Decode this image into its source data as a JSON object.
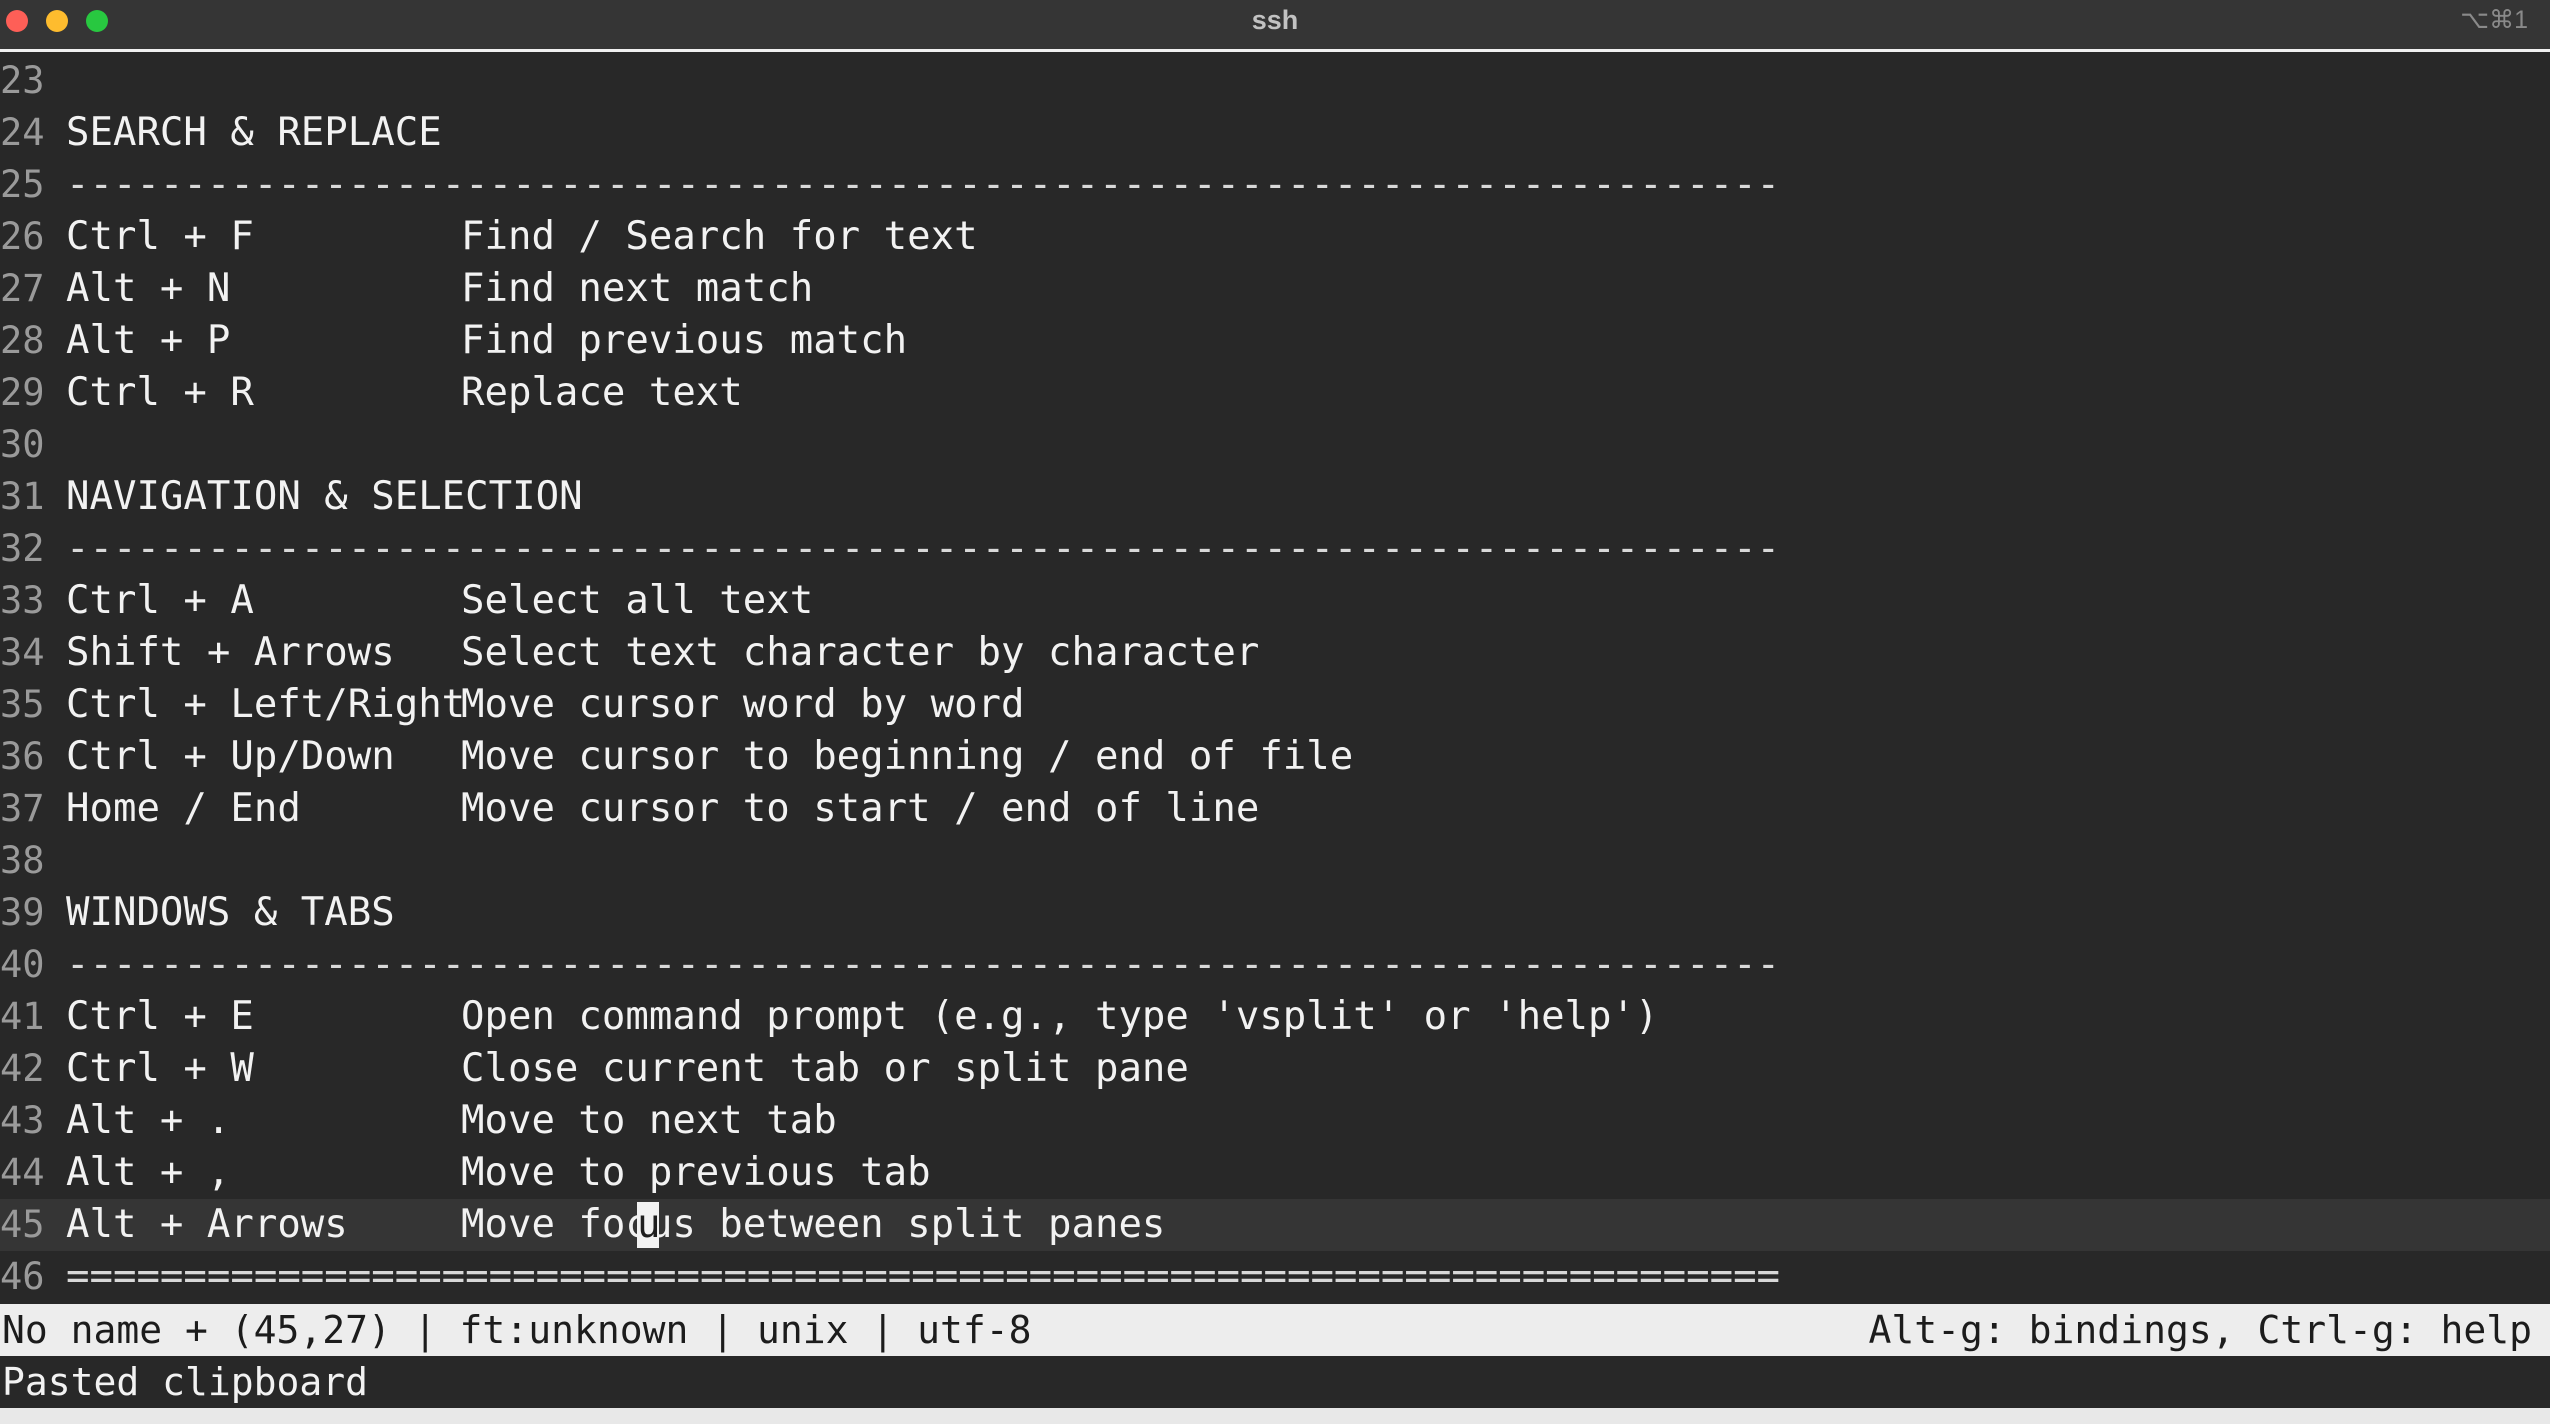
{
  "window": {
    "title": "ssh",
    "shortcut": "⌥⌘1"
  },
  "editor": {
    "lines": [
      {
        "n": "23",
        "type": "blank"
      },
      {
        "n": "24",
        "type": "heading",
        "text": "SEARCH & REPLACE"
      },
      {
        "n": "25",
        "type": "rule",
        "text": "-------------------------------------------------------------------------"
      },
      {
        "n": "26",
        "type": "binding",
        "key": "Ctrl + F",
        "desc": "Find / Search for text"
      },
      {
        "n": "27",
        "type": "binding",
        "key": "Alt + N",
        "desc": "Find next match"
      },
      {
        "n": "28",
        "type": "binding",
        "key": "Alt + P",
        "desc": "Find previous match"
      },
      {
        "n": "29",
        "type": "binding",
        "key": "Ctrl + R",
        "desc": "Replace text"
      },
      {
        "n": "30",
        "type": "blank"
      },
      {
        "n": "31",
        "type": "heading",
        "text": "NAVIGATION & SELECTION"
      },
      {
        "n": "32",
        "type": "rule",
        "text": "-------------------------------------------------------------------------"
      },
      {
        "n": "33",
        "type": "binding",
        "key": "Ctrl + A",
        "desc": "Select all text"
      },
      {
        "n": "34",
        "type": "binding",
        "key": "Shift + Arrows",
        "desc": "Select text character by character"
      },
      {
        "n": "35",
        "type": "binding",
        "key": "Ctrl + Left/Right",
        "desc": "Move cursor word by word"
      },
      {
        "n": "36",
        "type": "binding",
        "key": "Ctrl + Up/Down",
        "desc": "Move cursor to beginning / end of file"
      },
      {
        "n": "37",
        "type": "binding",
        "key": "Home / End",
        "desc": "Move cursor to start / end of line"
      },
      {
        "n": "38",
        "type": "blank"
      },
      {
        "n": "39",
        "type": "heading",
        "text": "WINDOWS & TABS"
      },
      {
        "n": "40",
        "type": "rule",
        "text": "-------------------------------------------------------------------------"
      },
      {
        "n": "41",
        "type": "binding",
        "key": "Ctrl + E",
        "desc": "Open command prompt (e.g., type 'vsplit' or 'help')"
      },
      {
        "n": "42",
        "type": "binding",
        "key": "Ctrl + W",
        "desc": "Close current tab or split pane"
      },
      {
        "n": "43",
        "type": "binding",
        "key": "Alt + .",
        "desc": "Move to next tab"
      },
      {
        "n": "44",
        "type": "binding",
        "key": "Alt + ,",
        "desc": "Move to previous tab"
      },
      {
        "n": "45",
        "type": "binding",
        "key": "Alt + Arrows",
        "desc": "Move focus between split panes",
        "current": true
      },
      {
        "n": "46",
        "type": "rule",
        "text": "========================================================================="
      }
    ],
    "cursor_char": "u"
  },
  "statusbar": {
    "left": "No name + (45,27) | ft:unknown | unix | utf-8",
    "right": "Alt-g: bindings, Ctrl-g: help"
  },
  "messagebar": {
    "text": "Pasted clipboard"
  },
  "colors": {
    "background": "#282828",
    "current_line": "#353535",
    "statusbar": "#ededed",
    "close": "#fe5f57",
    "minimize": "#febc2e",
    "maximize": "#28c840"
  }
}
